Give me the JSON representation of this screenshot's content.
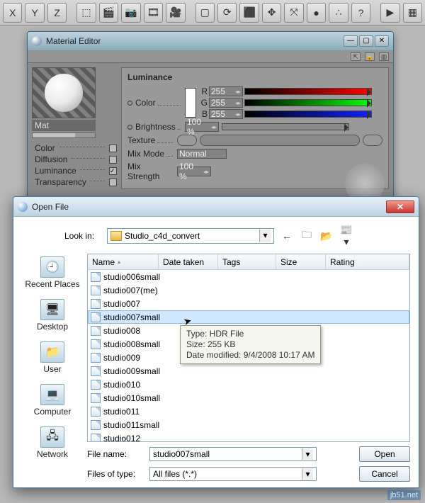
{
  "toolbar_icons": [
    "X",
    "Y",
    "Z",
    "⬚",
    "🎬",
    "📷",
    "🎞",
    "🎥",
    "▢",
    "⟳",
    "⬛",
    "✥",
    "⤧",
    "●",
    "∴",
    "?",
    "▶",
    "▦"
  ],
  "material_editor": {
    "title": "Material Editor",
    "win_btns": [
      "—",
      "▢",
      "✕"
    ],
    "mat_name": "Mat",
    "channels": [
      {
        "label": "Color",
        "checked": false
      },
      {
        "label": "Diffusion",
        "checked": false
      },
      {
        "label": "Luminance",
        "checked": true
      },
      {
        "label": "Transparency",
        "checked": false
      }
    ],
    "section_title": "Luminance",
    "color_label": "Color",
    "rgb": [
      {
        "ch": "R",
        "val": "255"
      },
      {
        "ch": "G",
        "val": "255"
      },
      {
        "ch": "B",
        "val": "255"
      }
    ],
    "brightness_label": "Brightness",
    "brightness_val": "100 %",
    "texture_label": "Texture",
    "mixmode_label": "Mix Mode",
    "mixmode_val": "Normal",
    "mixstr_label": "Mix Strength",
    "mixstr_val": "100 %"
  },
  "open_file": {
    "title": "Open File",
    "lookin_label": "Look in:",
    "lookin_value": "Studio_c4d_convert",
    "nav_icons": [
      "←",
      "🗀",
      "📂",
      "📰▾"
    ],
    "columns": [
      "Name",
      "Date taken",
      "Tags",
      "Size",
      "Rating"
    ],
    "places": [
      {
        "label": "Recent Places",
        "glyph": "🕘"
      },
      {
        "label": "Desktop",
        "glyph": "🖥"
      },
      {
        "label": "User",
        "glyph": "📁"
      },
      {
        "label": "Computer",
        "glyph": "💻"
      },
      {
        "label": "Network",
        "glyph": "🖧"
      }
    ],
    "files": [
      "studio006small",
      "studio007(me)",
      "studio007",
      "studio007small",
      "studio008",
      "studio008small",
      "studio009",
      "studio009small",
      "studio010",
      "studio010small",
      "studio011",
      "studio011small",
      "studio012"
    ],
    "selected_index": 3,
    "filename_label": "File name:",
    "filename_value": "studio007small",
    "filetype_label": "Files of type:",
    "filetype_value": "All files (*.*)",
    "open_btn": "Open",
    "cancel_btn": "Cancel",
    "tooltip": {
      "type": "Type: HDR File",
      "size": "Size: 255 KB",
      "modified": "Date modified: 9/4/2008 10:17 AM"
    }
  },
  "watermark": "jb51.net"
}
